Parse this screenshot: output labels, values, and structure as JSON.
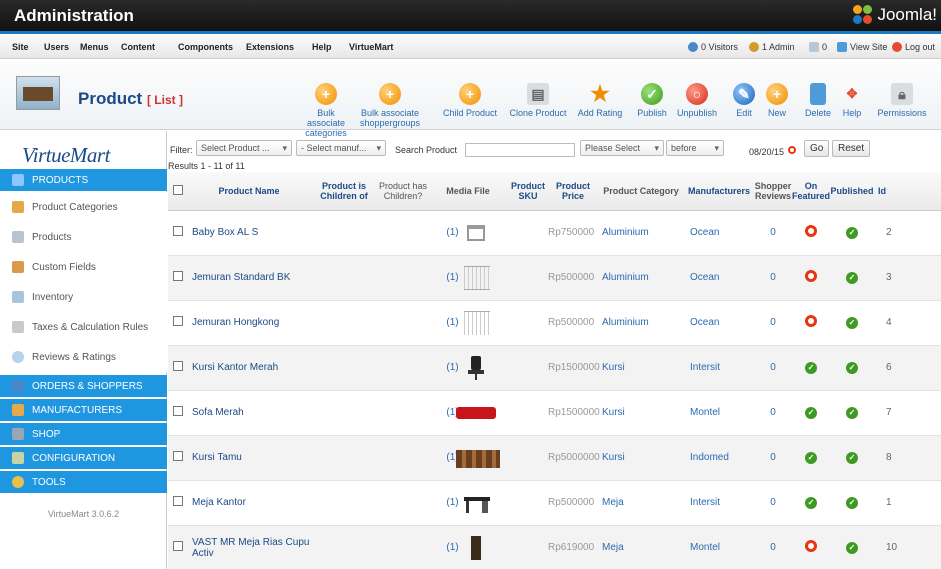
{
  "header": {
    "title": "Administration",
    "brand": "Joomla!"
  },
  "menubar": {
    "items": [
      "Site",
      "Users",
      "Menus",
      "Content",
      "Components",
      "Extensions",
      "Help",
      "VirtueMart"
    ],
    "visitors": "0 Visitors",
    "admins": "1 Admin",
    "messages": "0",
    "view_site": "View Site",
    "logout": "Log out"
  },
  "toolbar": {
    "page_title": "Product",
    "page_sub": "[ List ]",
    "buttons": [
      {
        "label": "Bulk associate categories",
        "icon": "add-icon"
      },
      {
        "label": "Bulk associate shoppergroups",
        "icon": "add-icon"
      },
      {
        "label": "Child Product",
        "icon": "add-icon"
      },
      {
        "label": "Clone Product",
        "icon": "clone-icon"
      },
      {
        "label": "Add Rating",
        "icon": "star-icon"
      },
      {
        "label": "Publish",
        "icon": "publish-icon"
      },
      {
        "label": "Unpublish",
        "icon": "unpublish-icon"
      },
      {
        "label": "Edit",
        "icon": "edit-icon"
      },
      {
        "label": "New",
        "icon": "new-icon"
      },
      {
        "label": "Delete",
        "icon": "trash-icon"
      },
      {
        "label": "Help",
        "icon": "help-icon"
      },
      {
        "label": "Permissions",
        "icon": "lock-icon"
      }
    ]
  },
  "sidebar": {
    "logo": "VirtueMart",
    "version": "VirtueMart 3.0.6.2",
    "sections": [
      {
        "label": "PRODUCTS"
      },
      {
        "label": "Product Categories"
      },
      {
        "label": "Products"
      },
      {
        "label": "Custom Fields"
      },
      {
        "label": "Inventory"
      },
      {
        "label": "Taxes & Calculation Rules"
      },
      {
        "label": "Reviews & Ratings"
      },
      {
        "label": "ORDERS & SHOPPERS"
      },
      {
        "label": "MANUFACTURERS"
      },
      {
        "label": "SHOP"
      },
      {
        "label": "CONFIGURATION"
      },
      {
        "label": "TOOLS"
      }
    ]
  },
  "filter": {
    "label": "Filter:",
    "select_product": "Select Product ...",
    "select_manufacturer": "- Select manuf...",
    "search_label": "Search Product",
    "search_value": "",
    "please_select": "Please Select",
    "before": "before",
    "date": "08/20/15",
    "go": "Go",
    "reset": "Reset",
    "results": "Results 1 - 11 of 11"
  },
  "table": {
    "headers": [
      "",
      "Product Name",
      "Product is Children of",
      "Product has Children?",
      "Media File",
      "Product SKU",
      "Product Price",
      "Product Category",
      "Manufacturers",
      "Shopper Reviews",
      "On Featured",
      "Published",
      "Id"
    ],
    "rows": [
      {
        "name": "Baby Box AL S",
        "media": "(1)",
        "price": "Rp750000",
        "category": "Aluminium",
        "manufacturer": "Ocean",
        "reviews": "0",
        "featured": "no",
        "published": "yes",
        "id": "2"
      },
      {
        "name": "Jemuran Standard BK",
        "media": "(1)",
        "price": "Rp500000",
        "category": "Aluminium",
        "manufacturer": "Ocean",
        "reviews": "0",
        "featured": "no",
        "published": "yes",
        "id": "3"
      },
      {
        "name": "Jemuran Hongkong",
        "media": "(1)",
        "price": "Rp500000",
        "category": "Aluminium",
        "manufacturer": "Ocean",
        "reviews": "0",
        "featured": "no",
        "published": "yes",
        "id": "4"
      },
      {
        "name": "Kursi Kantor Merah",
        "media": "(1)",
        "price": "Rp1500000",
        "category": "Kursi",
        "manufacturer": "Intersit",
        "reviews": "0",
        "featured": "yes",
        "published": "yes",
        "id": "6"
      },
      {
        "name": "Sofa Merah",
        "media": "(1)",
        "price": "Rp1500000",
        "category": "Kursi",
        "manufacturer": "Montel",
        "reviews": "0",
        "featured": "yes",
        "published": "yes",
        "id": "7"
      },
      {
        "name": "Kursi Tamu",
        "media": "(1)",
        "price": "Rp5000000",
        "category": "Kursi",
        "manufacturer": "Indomed",
        "reviews": "0",
        "featured": "yes",
        "published": "yes",
        "id": "8"
      },
      {
        "name": "Meja Kantor",
        "media": "(1)",
        "price": "Rp500000",
        "category": "Meja",
        "manufacturer": "Intersit",
        "reviews": "0",
        "featured": "yes",
        "published": "yes",
        "id": "1"
      },
      {
        "name": "VAST MR Meja Rias Cupu Activ",
        "media": "(1)",
        "price": "Rp619000",
        "category": "Meja",
        "manufacturer": "Montel",
        "reviews": "0",
        "featured": "no",
        "published": "yes",
        "id": "10"
      }
    ]
  }
}
